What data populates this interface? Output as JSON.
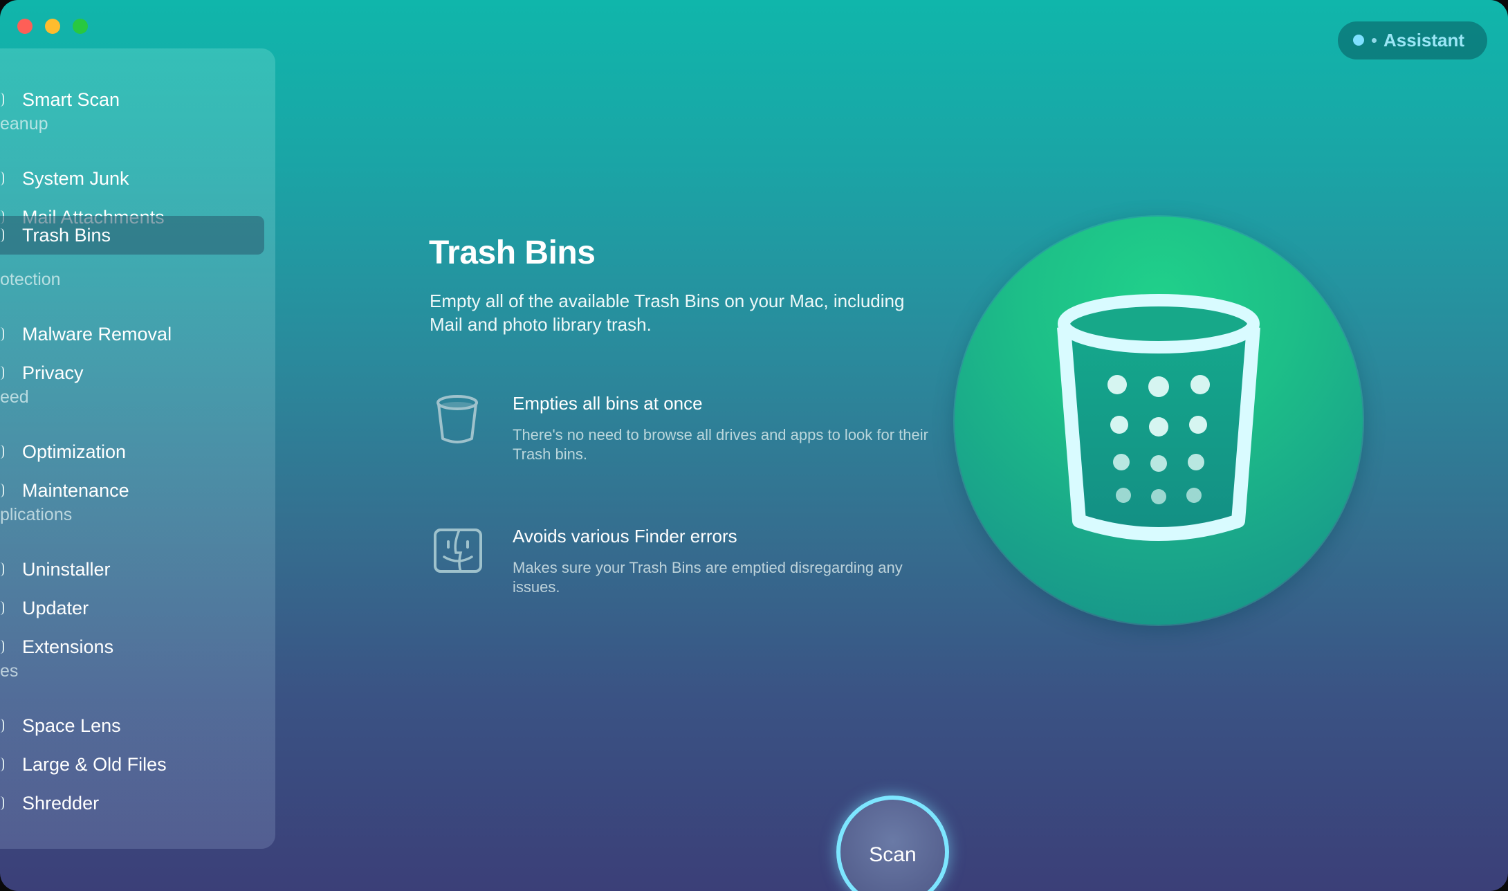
{
  "window": {
    "controls": [
      "close",
      "minimize",
      "zoom"
    ]
  },
  "assistant": {
    "label": "Assistant"
  },
  "sidebar": {
    "top_item": {
      "label": "Smart Scan",
      "icon": "smart-scan-icon"
    },
    "sections": [
      {
        "title": "eanup",
        "items": [
          {
            "label": "System Junk",
            "icon": "system-junk-icon"
          },
          {
            "label": "Mail Attachments",
            "icon": "mail-attachments-icon"
          },
          {
            "label": "Trash Bins",
            "icon": "trash-bins-icon",
            "active": true
          }
        ]
      },
      {
        "title": "otection",
        "items": [
          {
            "label": "Malware Removal",
            "icon": "malware-removal-icon"
          },
          {
            "label": "Privacy",
            "icon": "privacy-icon"
          }
        ]
      },
      {
        "title": "eed",
        "items": [
          {
            "label": "Optimization",
            "icon": "optimization-icon"
          },
          {
            "label": "Maintenance",
            "icon": "maintenance-icon"
          }
        ]
      },
      {
        "title": "plications",
        "items": [
          {
            "label": "Uninstaller",
            "icon": "uninstaller-icon"
          },
          {
            "label": "Updater",
            "icon": "updater-icon"
          },
          {
            "label": "Extensions",
            "icon": "extensions-icon"
          }
        ]
      },
      {
        "title": "es",
        "items": [
          {
            "label": "Space Lens",
            "icon": "space-lens-icon"
          },
          {
            "label": "Large & Old Files",
            "icon": "large-old-files-icon"
          },
          {
            "label": "Shredder",
            "icon": "shredder-icon"
          }
        ]
      }
    ]
  },
  "main": {
    "title": "Trash Bins",
    "description": "Empty all of the available Trash Bins on your Mac, including Mail and photo library trash.",
    "features": [
      {
        "icon": "trash-can-icon",
        "title": "Empties all bins at once",
        "description": "There's no need to browse all drives and apps to look for their Trash bins."
      },
      {
        "icon": "finder-icon",
        "title": "Avoids various Finder errors",
        "description": "Makes sure your Trash Bins are emptied disregarding any issues."
      }
    ],
    "hero_icon": "trash-bin-icon",
    "scan_label": "Scan"
  },
  "colors": {
    "background_top": "#10b6ab",
    "background_bottom": "#3b3f78",
    "hero_green": "#1dbf88",
    "scan_ring": "#7de6ff"
  }
}
